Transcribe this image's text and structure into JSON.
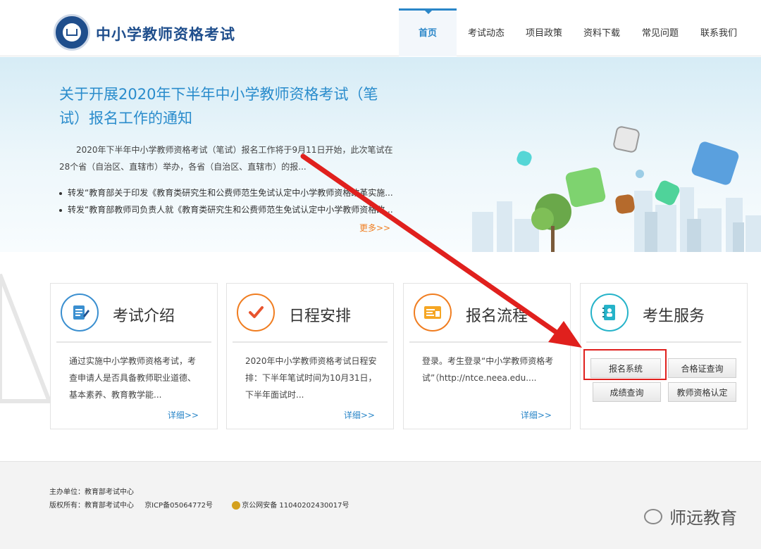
{
  "header": {
    "site_title": "中小学教师资格考试",
    "nav": [
      {
        "label": "首页",
        "active": true
      },
      {
        "label": "考试动态"
      },
      {
        "label": "项目政策"
      },
      {
        "label": "资料下载"
      },
      {
        "label": "常见问题"
      },
      {
        "label": "联系我们"
      }
    ]
  },
  "banner": {
    "title": "关于开展2020年下半年中小学教师资格考试（笔试）报名工作的通知",
    "summary": "2020年下半年中小学教师资格考试（笔试）报名工作将于9月11日开始，此次笔试在28个省（自治区、直辖市）举办，各省（自治区、直辖市）的报...",
    "links": [
      "转发“教育部关于印发《教育类研究生和公费师范生免试认定中小学教师资格改革实施...",
      "转发“教育部教师司负责人就《教育类研究生和公费师范生免试认定中小学教师资格改..."
    ],
    "more": "更多>>"
  },
  "cards": [
    {
      "title": "考试介绍",
      "text": "通过实施中小学教师资格考试，考查申请人是否具备教师职业道德、基本素养、教育教学能...",
      "more": "详细>>",
      "icon": "document-icon"
    },
    {
      "title": "日程安排",
      "text": "2020年中小学教师资格考试日程安排：下半年笔试时间为10月31日，下半年面试时...",
      "more": "详细>>",
      "icon": "checkmark-icon"
    },
    {
      "title": "报名流程",
      "text": "登录。考生登录“中小学教师资格考试”（http://ntce.neea.edu....",
      "more": "详细>>",
      "icon": "form-icon"
    },
    {
      "title": "考生服务",
      "icon": "contact-book-icon",
      "buttons": [
        "报名系统",
        "合格证查询",
        "成绩查询",
        "教师资格认定"
      ]
    }
  ],
  "footer": {
    "host_label": "主办单位：",
    "host_value": "教育部考试中心",
    "copyright_label": "版权所有：",
    "copyright_value": "教育部考试中心",
    "icp": "京ICP备05064772号",
    "police": "京公网安备 11040202430017号"
  },
  "watermark": "师远教育",
  "colors": {
    "brand_blue": "#1f4e8c",
    "accent_blue": "#2a86c8",
    "more_orange": "#f07d20",
    "annotation_red": "#e0201d"
  }
}
